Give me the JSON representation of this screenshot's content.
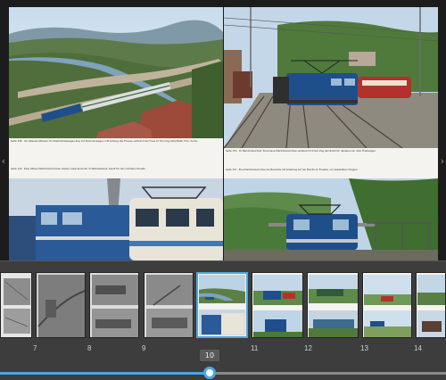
{
  "viewer": {
    "prev_icon": "chevron-left-icon",
    "next_icon": "chevron-right-icon",
    "prev_glyph": "‹",
    "next_glyph": "›",
    "left_page": {
      "caption_top": "Seite 148 · Am Wasserkraftwerk: Ein Elektrotriebwagen-Zug mit Personenwagen rollt entlang des Flusses, während der Fluss im Tal ruhig dahinfließt. Foto: Archiv",
      "caption_bottom": "Seite 149 · Zwei Altbau-Elektrolokomotiven stehen nebeneinander im Betriebswerk, bereit für den nächsten Einsatz."
    },
    "right_page": {
      "caption_top": "Seite 150 · Im Bahnhofsvorfeld: Eine blaue Elektrolokomotive verlässt mit ihrem Zug den Bahnhof, daneben ein roter Triebwagen.",
      "caption_bottom": "Seite 151 · Eine Elektrolokomotive der Baureihe mit Güterzug auf der Brücke im Flusstal, vor bewaldeten Hängen."
    }
  },
  "thumbnails": [
    {
      "label": "7"
    },
    {
      "label": "8"
    },
    {
      "label": "9"
    },
    {
      "label": "10"
    },
    {
      "label": "11"
    },
    {
      "label": "12"
    },
    {
      "label": "13"
    },
    {
      "label": "14"
    }
  ],
  "scrollbar": {
    "current_page": "10",
    "position": 0.47
  },
  "colors": {
    "accent": "#4ea6dd",
    "background": "#2b2b2b",
    "loco_blue": "#1f4f8a"
  }
}
